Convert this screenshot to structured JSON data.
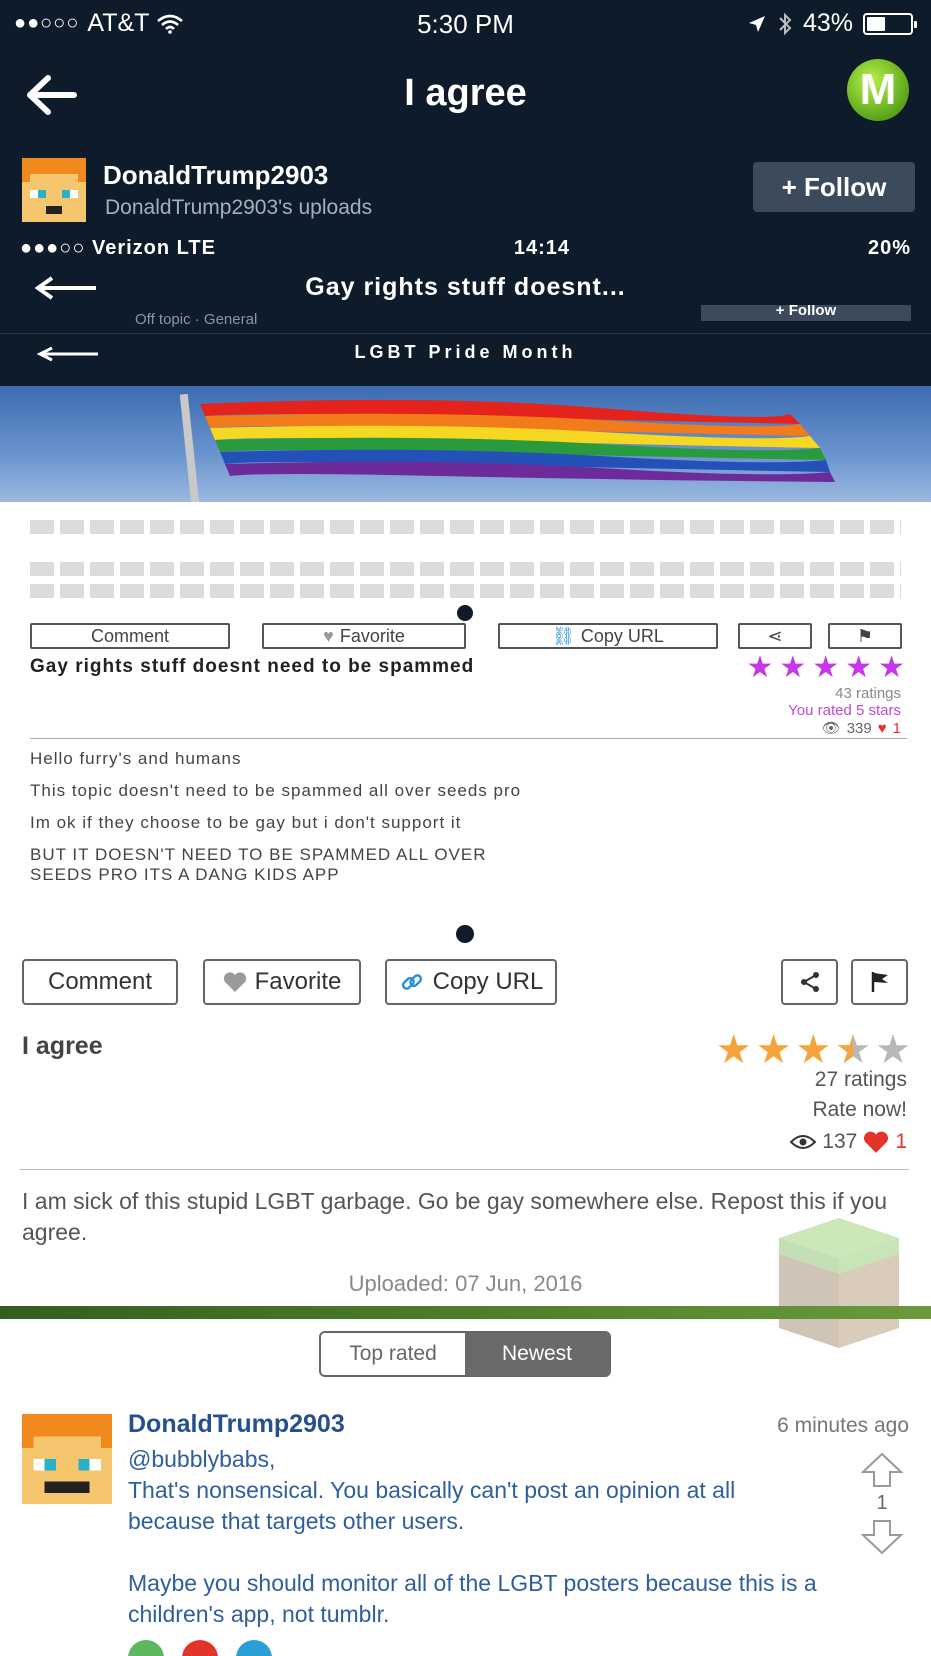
{
  "status_bar": {
    "carrier": "AT&T",
    "time": "5:30 PM",
    "battery": "43%",
    "battery_level": 0.43
  },
  "nav": {
    "title": "I agree",
    "logo_letter": "M"
  },
  "author": {
    "name": "DonaldTrump2903",
    "uploads_label": "DonaldTrump2903's uploads",
    "follow_label": "+ Follow"
  },
  "embedded_screenshot": {
    "status": {
      "carrier": "●●●○○ Verizon  LTE",
      "time": "14:14",
      "battery": "20%"
    },
    "title": "Gay rights stuff doesnt...",
    "subtitle": "Off topic · General",
    "follow_label": "+ Follow",
    "inner_title": "LGBT Pride Month",
    "actions": {
      "comment": "Comment",
      "favorite": "Favorite",
      "copy_url": "Copy URL"
    },
    "post_title": "Gay rights stuff doesnt need to be spammed",
    "ratings": "43 ratings",
    "rated": "You rated 5 stars",
    "views": "339",
    "likes": "1",
    "body_lines": [
      "Hello furry's and humans",
      "This topic doesn't need to be spammed all over seeds pro",
      "Im ok if they choose to be gay but i don't support it",
      "BUT IT DOESN'T NEED TO BE SPAMMED ALL OVER",
      "SEEDS PRO ITS A DANG KIDS APP"
    ]
  },
  "actions": {
    "comment": "Comment",
    "favorite": "Favorite",
    "copy_url": "Copy URL"
  },
  "post": {
    "title": "I agree",
    "rating_value": 3.5,
    "ratings": "27 ratings",
    "rate_now": "Rate now!",
    "views": "137",
    "likes": "1",
    "body": "I am sick of this stupid LGBT garbage. Go be gay somewhere else. Repost this if you agree.",
    "uploaded": "Uploaded: 07 Jun, 2016"
  },
  "sort_tabs": {
    "top_rated": "Top rated",
    "newest": "Newest",
    "active": "Newest"
  },
  "comment": {
    "author": "DonaldTrump2903",
    "time": "6 minutes ago",
    "mention": "@bubblybabs,",
    "line1": "That's nonsensical. You basically can't post an opinion at all because that targets other users.",
    "line2": "Maybe you should monitor all of the LGBT posters because this is a children's app, not tumblr.",
    "votes": "1"
  },
  "colors": {
    "header_bg": "#0d1b2a",
    "accent_blue": "#25508f",
    "star_orange": "#f7a33b",
    "star_purple": "#c537e8",
    "heart_red": "#e2342a"
  }
}
